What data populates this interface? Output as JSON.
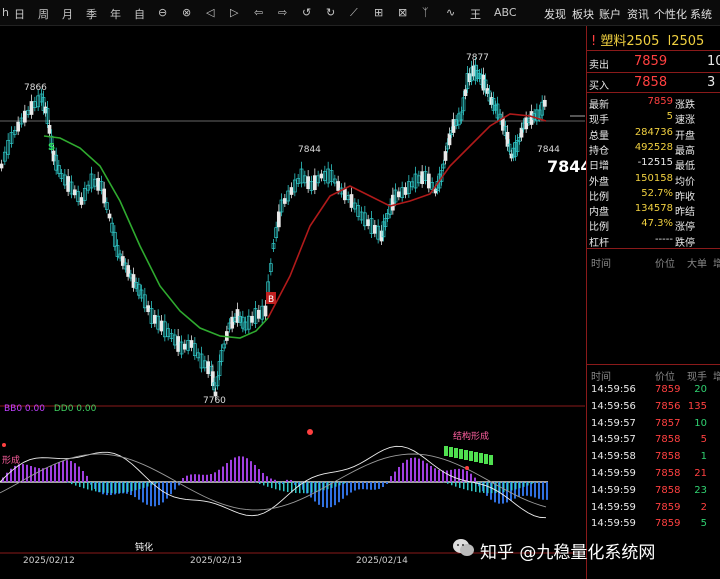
{
  "toolbar": {
    "left_items": [
      "h",
      "日",
      "周",
      "月",
      "季",
      "年",
      "自",
      "⊖",
      "⊗",
      "◁",
      "▷",
      "⇦",
      "⇨",
      "↺",
      "↻",
      "⟋",
      "⊞",
      "⊠",
      "ᛉ",
      "∿",
      "王",
      "ABC"
    ],
    "right_items": [
      "发现",
      "板块",
      "账户",
      "资讯",
      "个性化",
      "系统工"
    ]
  },
  "chart": {
    "price_labels": {
      "high1": "7866",
      "mid": "7844",
      "high2": "7877",
      "low": "7760",
      "right": "7844",
      "big": "7844"
    },
    "markers": {
      "s": "S",
      "b": "B"
    },
    "indicator": {
      "bb0": "BB0 0.00",
      "dd0": "DD0 0.00"
    },
    "annotations": {
      "left": "形成",
      "struct": "结构形成",
      "dun": "钝化",
      "dun2": "钝化"
    },
    "dates": [
      "2025/02/12",
      "2025/02/13",
      "2025/02/14"
    ]
  },
  "panel": {
    "title_name": "塑料2505",
    "title_code": "l2505",
    "sell_label": "卖出",
    "sell_price": "7859",
    "sell_vol": "10",
    "buy_label": "买入",
    "buy_price": "7858",
    "buy_vol": "3",
    "stats": [
      {
        "label": "最新",
        "value": "7859",
        "label2": "涨跌"
      },
      {
        "label": "现手",
        "value": "5",
        "label2": "速涨"
      },
      {
        "label": "总量",
        "value": "284736",
        "label2": "开盘"
      },
      {
        "label": "持仓",
        "value": "492528",
        "label2": "最高"
      },
      {
        "label": "日增",
        "value": "-12515",
        "label2": "最低"
      },
      {
        "label": "外盘",
        "value": "150158",
        "label2": "均价"
      },
      {
        "label": "比例",
        "value": "52.7%",
        "label2": "昨收"
      },
      {
        "label": "内盘",
        "value": "134578",
        "label2": "昨结"
      },
      {
        "label": "比例",
        "value": "47.3%",
        "label2": "涨停"
      },
      {
        "label": "杠杆",
        "value": "-----",
        "label2": "跌停"
      }
    ],
    "tick_header": {
      "time": "时间",
      "price": "价位",
      "vol": "大单",
      "inc": "增"
    },
    "tick_header2": {
      "time": "时间",
      "price": "价位",
      "vol": "现手",
      "inc": "增"
    },
    "ticks": [
      {
        "time": "14:59:56",
        "price": "7859",
        "vol": "20"
      },
      {
        "time": "14:59:56",
        "price": "7856",
        "vol": "135"
      },
      {
        "time": "14:59:57",
        "price": "7857",
        "vol": "10"
      },
      {
        "time": "14:59:57",
        "price": "7858",
        "vol": "5"
      },
      {
        "time": "14:59:58",
        "price": "7858",
        "vol": "1"
      },
      {
        "time": "14:59:59",
        "price": "7858",
        "vol": "21"
      },
      {
        "time": "14:59:59",
        "price": "7858",
        "vol": "23"
      },
      {
        "time": "14:59:59",
        "price": "7859",
        "vol": "2"
      },
      {
        "time": "14:59:59",
        "price": "7859",
        "vol": "5"
      }
    ]
  },
  "watermark": "知乎 @九稳量化系统网",
  "colors": {
    "up": "#30c8c8",
    "down": "#e8e8e8",
    "ma_green": "#2faa2f",
    "ma_red": "#b01a1a",
    "accent_red": "#ff4040"
  }
}
